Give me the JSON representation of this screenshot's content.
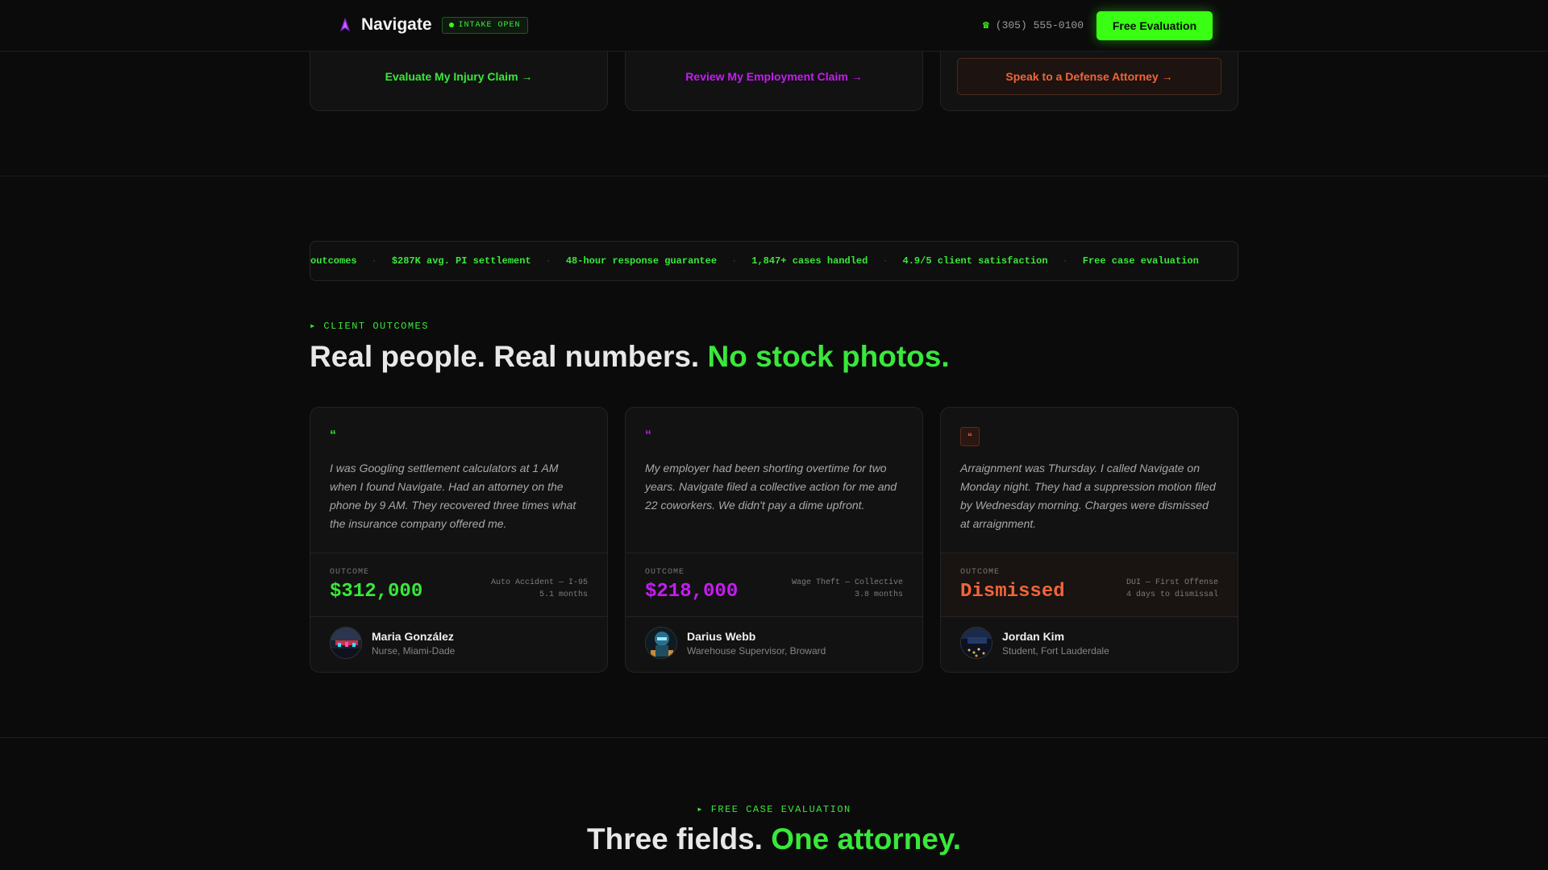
{
  "header": {
    "brand": "Navigate",
    "badge": "INTAKE OPEN",
    "phone": "(305) 555-0100",
    "cta": "Free Evaluation"
  },
  "practice_links": [
    {
      "label": "Evaluate My Injury Claim →"
    },
    {
      "label": "Review My Employment Claim →"
    },
    {
      "label": "Speak to a Defense Attorney →"
    }
  ],
  "ticker": [
    "outcomes",
    "$287K avg. PI settlement",
    "48-hour response guarantee",
    "1,847+ cases handled",
    "4.9/5 client satisfaction",
    "Free case evaluation"
  ],
  "outcomes_section": {
    "eyebrow": "▸ CLIENT OUTCOMES",
    "heading_main": "Real people. Real numbers. ",
    "heading_highlight": "No stock photos."
  },
  "testimonials": [
    {
      "quote_mark": "“",
      "quote": "I was Googling settlement calculators at 1 AM when I found Navigate. Had an attorney on the phone by 9 AM. They recovered three times what the insurance company offered me.",
      "outcome_label": "OUTCOME",
      "outcome_value": "$312,000",
      "case_type": "Auto Accident — I-95",
      "duration": "5.1 months",
      "name": "Maria González",
      "role": "Nurse, Miami-Dade",
      "accent": "#39e83a"
    },
    {
      "quote_mark": "“",
      "quote": "My employer had been shorting overtime for two years. Navigate filed a collective action for me and 22 coworkers. We didn't pay a dime upfront.",
      "outcome_label": "OUTCOME",
      "outcome_value": "$218,000",
      "case_type": "Wage Theft — Collective",
      "duration": "3.8 months",
      "name": "Darius Webb",
      "role": "Warehouse Supervisor, Broward",
      "accent": "#c41df0"
    },
    {
      "quote_mark": "“",
      "quote": "Arraignment was Thursday. I called Navigate on Monday night. They had a suppression motion filed by Wednesday morning. Charges were dismissed at arraignment.",
      "outcome_label": "OUTCOME",
      "outcome_value": "Dismissed",
      "case_type": "DUI — First Offense",
      "duration": "4 days to dismissal",
      "name": "Jordan Kim",
      "role": "Student, Fort Lauderdale",
      "accent": "#f0653a"
    }
  ],
  "evaluation_section": {
    "eyebrow": "▸ FREE CASE EVALUATION",
    "heading_main": "Three fields. ",
    "heading_highlight": "One attorney."
  }
}
